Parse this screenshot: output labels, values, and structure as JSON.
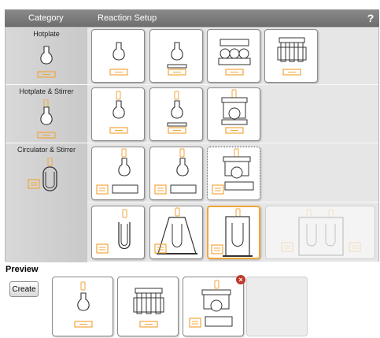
{
  "header": {
    "category": "Category",
    "reaction_setup": "Reaction Setup",
    "help_icon": "?"
  },
  "categories": [
    {
      "label": "Hotplate"
    },
    {
      "label": "Hotplate & Stirrer"
    },
    {
      "label": "Circulator & Stirrer"
    }
  ],
  "preview": {
    "title": "Preview",
    "create_label": "Create",
    "remove_badge": "×"
  },
  "colors": {
    "accent": "#f2a53b",
    "header": "#767676",
    "category_bg": "#d2d2d2",
    "row_bg": "#e6e6e6",
    "remove": "#c0392b"
  },
  "icons": {
    "flask": "round-flask-icon",
    "reactor": "multi-reactor-icon",
    "hotplate": "hotplate-icon",
    "stirrer": "stirrer-icon",
    "circulator": "circulator-icon"
  }
}
